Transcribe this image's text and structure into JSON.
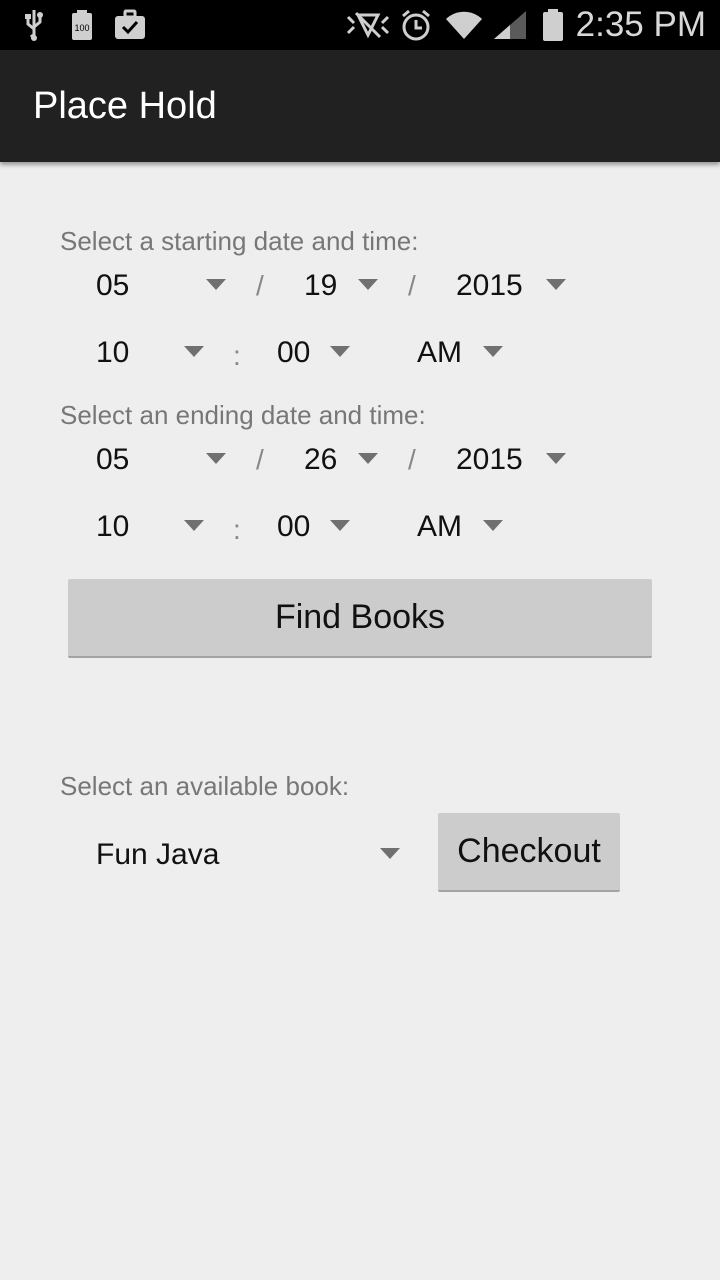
{
  "status_bar": {
    "time": "2:35 PM",
    "battery_small_label": "100",
    "icons": [
      "usb-icon",
      "battery-100-icon",
      "briefcase-check-icon",
      "nfc-muted-icon",
      "alarm-icon",
      "wifi-icon",
      "signal-icon",
      "battery-icon"
    ]
  },
  "action_bar": {
    "title": "Place Hold"
  },
  "start": {
    "label": "Select a starting date and time:",
    "month": "05",
    "day": "19",
    "year": "2015",
    "hour": "10",
    "minute": "00",
    "ampm": "AM"
  },
  "end": {
    "label": "Select an ending date and time:",
    "month": "05",
    "day": "26",
    "year": "2015",
    "hour": "10",
    "minute": "00",
    "ampm": "AM"
  },
  "separators": {
    "date": "/",
    "time": ":"
  },
  "find_books_label": "Find Books",
  "book": {
    "label": "Select an available book:",
    "selected": "Fun Java",
    "checkout_label": "Checkout"
  }
}
